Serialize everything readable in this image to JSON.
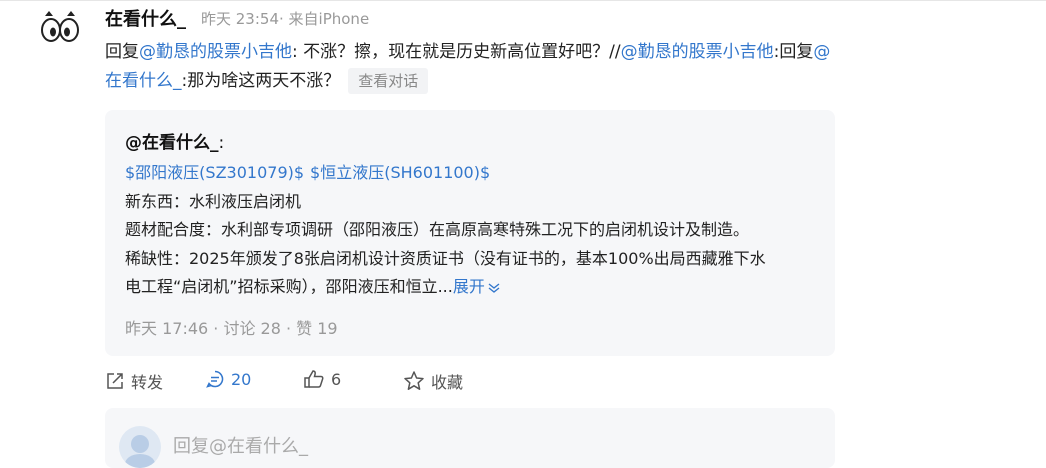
{
  "post": {
    "username": "在看什么_",
    "time": "昨天 23:54",
    "source": "· 来自iPhone",
    "reply": {
      "prefix": "回复",
      "mention1": "@勤恳的股票小吉他",
      "text1": ": 不涨？擦，现在就是历史新高位置好吧？//",
      "mention2": "@勤恳的股票小吉他",
      "text2": ":回复",
      "mention3": "@在看什么_",
      "text3": ":那为啥这两天不涨？",
      "view_conversation": "查看对话"
    }
  },
  "quote": {
    "author": "@在看什么_",
    "colon": ":",
    "stocks": [
      "$邵阳液压(SZ301079)$",
      "$恒立液压(SH601100)$"
    ],
    "line1": "新东西：水利液压启闭机",
    "line2": "题材配合度：水利部专项调研（邵阳液压）在高原高寒特殊工况下的启闭机设计及制造。",
    "line3": "稀缺性：2025年颁发了8张启闭机设计资质证书（没有证书的，基本100%出局西藏雅下水",
    "line4": "电工程“启闭机”招标采购），邵阳液压和恒立...",
    "expand": "展开",
    "time": "昨天 17:46",
    "stats": " · 讨论 28 · 赞 19"
  },
  "actions": {
    "repost": "转发",
    "comment_count": "20",
    "like_count": "6",
    "favorite": "收藏"
  },
  "reply_box": {
    "placeholder": "回复@在看什么_"
  },
  "colors": {
    "link": "#3377cc",
    "muted": "#999999",
    "card_bg": "#f6f7f9"
  },
  "icons": [
    "owl-avatar-icon",
    "chevron-down-icon",
    "repost-icon",
    "comment-icon",
    "thumbs-up-icon",
    "star-icon"
  ]
}
